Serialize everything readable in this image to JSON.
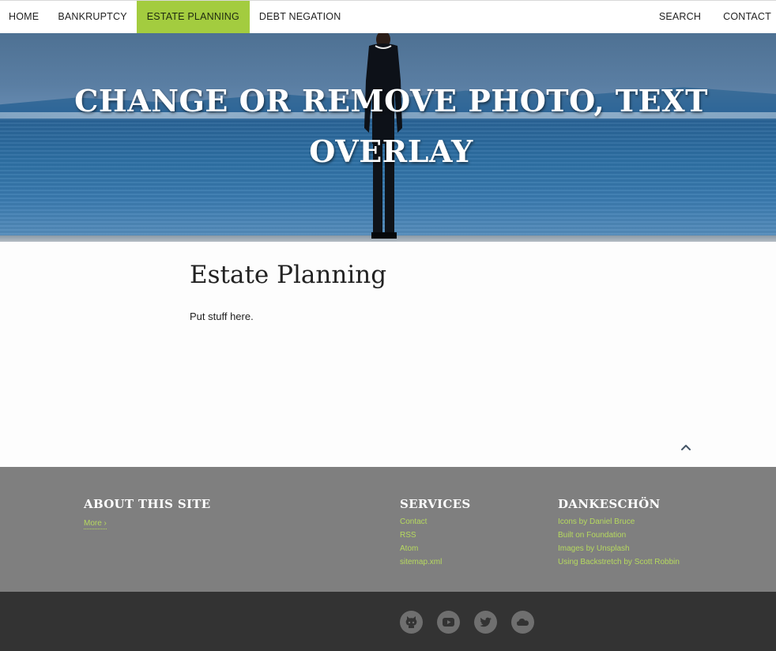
{
  "nav": {
    "left": [
      {
        "label": "HOME"
      },
      {
        "label": "BANKRUPTCY"
      },
      {
        "label": "ESTATE PLANNING",
        "active": true
      },
      {
        "label": "DEBT NEGATION"
      }
    ],
    "right": [
      {
        "label": "SEARCH"
      },
      {
        "label": "CONTACT"
      }
    ]
  },
  "hero": {
    "title": "CHANGE OR REMOVE PHOTO, TEXT OVERLAY"
  },
  "main": {
    "heading": "Estate Planning",
    "body": "Put stuff here."
  },
  "footer": {
    "about": {
      "title": "ABOUT THIS SITE",
      "more_label": "More ›"
    },
    "services": {
      "title": "SERVICES",
      "links": [
        "Contact",
        "RSS",
        "Atom",
        "sitemap.xml"
      ]
    },
    "thanks": {
      "title": "DANKESCHÖN",
      "links": [
        "Icons by Daniel Bruce",
        "Built on Foundation",
        "Images by Unsplash",
        "Using Backstretch by Scott Robbin"
      ]
    }
  },
  "social": [
    "github-icon",
    "youtube-icon",
    "twitter-icon",
    "cloud-icon"
  ],
  "colors": {
    "accent": "#a3cc3f",
    "link": "#b6d95f",
    "footer_bg": "#7f7f7f",
    "bottom_bg": "#333333"
  }
}
